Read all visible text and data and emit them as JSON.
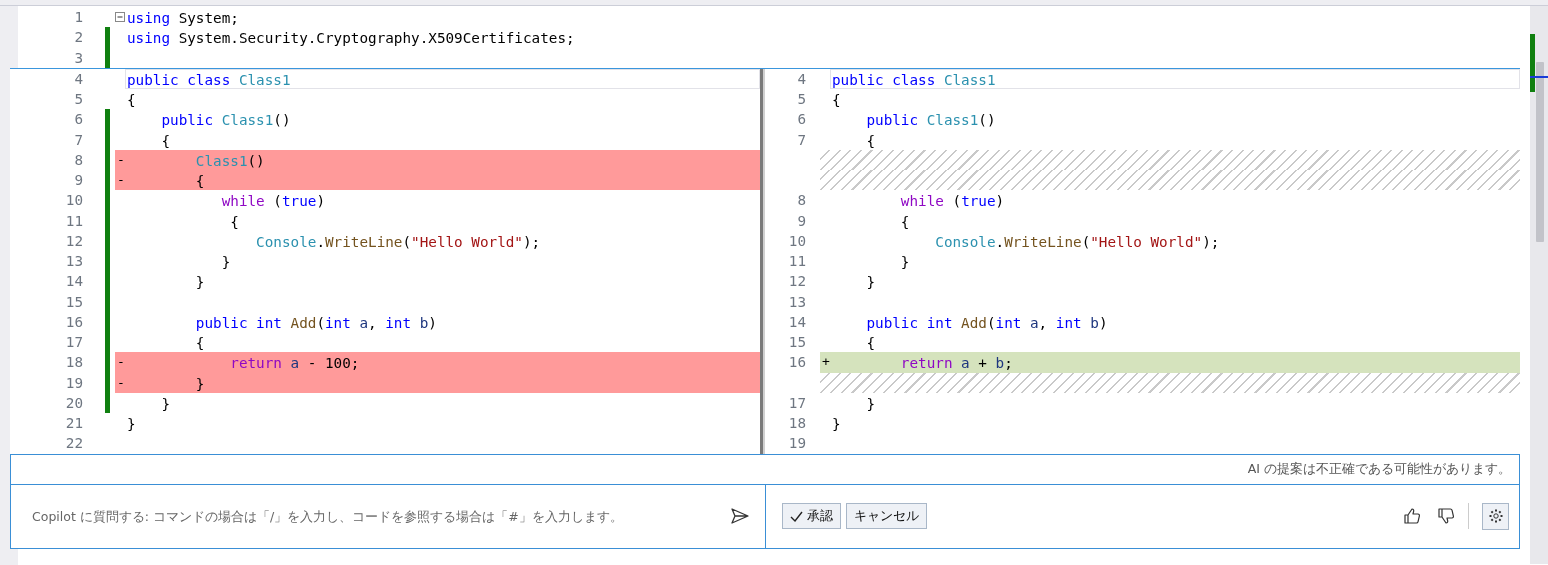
{
  "top_lines": [
    {
      "n": "1",
      "changed": false,
      "fold": true,
      "tokens": [
        {
          "kind": "kw",
          "text": "using"
        },
        {
          "kind": "plain",
          "text": " System;"
        }
      ]
    },
    {
      "n": "2",
      "changed": true,
      "fold": false,
      "tokens": [
        {
          "kind": "kw",
          "text": "using"
        },
        {
          "kind": "plain",
          "text": " System.Security.Cryptography.X509Certificates;"
        }
      ]
    },
    {
      "n": "3",
      "changed": true,
      "fold": false
    }
  ],
  "diff": {
    "left": [
      {
        "n": "4",
        "kind": "normal",
        "changed": false,
        "current": true,
        "tokens": [
          {
            "kind": "kw",
            "text": "public class"
          },
          {
            "kind": "type",
            "text": " Class1"
          }
        ]
      },
      {
        "n": "5",
        "kind": "normal",
        "changed": false,
        "current": false,
        "tokens": [
          {
            "kind": "plain",
            "text": "{"
          }
        ]
      },
      {
        "n": "6",
        "kind": "normal",
        "changed": true,
        "current": false,
        "tokens": [
          {
            "kind": "kw",
            "text": "    public"
          },
          {
            "kind": "type",
            "text": " Class1"
          },
          {
            "kind": "plain",
            "text": "()"
          }
        ]
      },
      {
        "n": "7",
        "kind": "normal",
        "changed": true,
        "current": false,
        "tokens": [
          {
            "kind": "plain",
            "text": "    {"
          }
        ]
      },
      {
        "n": "8",
        "kind": "removed",
        "marker": "-",
        "changed": true,
        "current": false,
        "tokens": [
          {
            "kind": "type",
            "text": "        Class1"
          },
          {
            "kind": "plain",
            "text": "()"
          }
        ]
      },
      {
        "n": "9",
        "kind": "removed",
        "marker": "-",
        "changed": true,
        "current": false,
        "tokens": [
          {
            "kind": "plain",
            "text": "        {"
          }
        ]
      },
      {
        "n": "10",
        "kind": "normal",
        "changed": true,
        "current": false,
        "tokens": [
          {
            "kind": "ctl",
            "text": "           while"
          },
          {
            "kind": "plain",
            "text": " ("
          },
          {
            "kind": "kw",
            "text": "true"
          },
          {
            "kind": "plain",
            "text": ")"
          }
        ]
      },
      {
        "n": "11",
        "kind": "normal",
        "changed": true,
        "current": false,
        "tokens": [
          {
            "kind": "plain",
            "text": "            {"
          }
        ]
      },
      {
        "n": "12",
        "kind": "normal",
        "changed": true,
        "current": false,
        "tokens": [
          {
            "kind": "type",
            "text": "               Console"
          },
          {
            "kind": "plain",
            "text": "."
          },
          {
            "kind": "method",
            "text": "WriteLine"
          },
          {
            "kind": "plain",
            "text": "("
          },
          {
            "kind": "str",
            "text": "\"Hello World\""
          },
          {
            "kind": "plain",
            "text": ");"
          }
        ]
      },
      {
        "n": "13",
        "kind": "normal",
        "changed": true,
        "current": false,
        "tokens": [
          {
            "kind": "plain",
            "text": "           }"
          }
        ]
      },
      {
        "n": "14",
        "kind": "normal",
        "changed": true,
        "current": false,
        "tokens": [
          {
            "kind": "plain",
            "text": "        }"
          }
        ]
      },
      {
        "n": "15",
        "kind": "normal",
        "changed": true,
        "current": false
      },
      {
        "n": "16",
        "kind": "normal",
        "changed": true,
        "current": false,
        "tokens": [
          {
            "kind": "kw",
            "text": "        public int"
          },
          {
            "kind": "method",
            "text": " Add"
          },
          {
            "kind": "plain",
            "text": "("
          },
          {
            "kind": "kw",
            "text": "int"
          },
          {
            "kind": "param",
            "text": " a"
          },
          {
            "kind": "plain",
            "text": ", "
          },
          {
            "kind": "kw",
            "text": "int"
          },
          {
            "kind": "param",
            "text": " b"
          },
          {
            "kind": "plain",
            "text": ")"
          }
        ]
      },
      {
        "n": "17",
        "kind": "normal",
        "changed": true,
        "current": false,
        "tokens": [
          {
            "kind": "plain",
            "text": "        {"
          }
        ]
      },
      {
        "n": "18",
        "kind": "removed",
        "marker": "-",
        "changed": true,
        "current": false,
        "tokens": [
          {
            "kind": "ctl",
            "text": "            return"
          },
          {
            "kind": "param",
            "text": " a"
          },
          {
            "kind": "plain",
            "text": " - 100;"
          }
        ]
      },
      {
        "n": "19",
        "kind": "removed",
        "marker": "-",
        "changed": true,
        "current": false,
        "tokens": [
          {
            "kind": "plain",
            "text": "        }"
          }
        ]
      },
      {
        "n": "20",
        "kind": "normal",
        "changed": true,
        "current": false,
        "tokens": [
          {
            "kind": "plain",
            "text": "    }"
          }
        ]
      },
      {
        "n": "21",
        "kind": "normal",
        "changed": false,
        "current": false,
        "tokens": [
          {
            "kind": "plain",
            "text": "}"
          }
        ]
      },
      {
        "n": "22",
        "kind": "normal",
        "changed": false,
        "current": false
      }
    ],
    "right": [
      {
        "n": "4",
        "kind": "normal",
        "current": true,
        "tokens": [
          {
            "kind": "kw",
            "text": "public class"
          },
          {
            "kind": "type",
            "text": " Class1"
          }
        ]
      },
      {
        "n": "5",
        "kind": "normal",
        "current": false,
        "tokens": [
          {
            "kind": "plain",
            "text": "{"
          }
        ]
      },
      {
        "n": "6",
        "kind": "normal",
        "current": false,
        "tokens": [
          {
            "kind": "kw",
            "text": "    public"
          },
          {
            "kind": "type",
            "text": " Class1"
          },
          {
            "kind": "plain",
            "text": "()"
          }
        ]
      },
      {
        "n": "7",
        "kind": "normal",
        "current": false,
        "tokens": [
          {
            "kind": "plain",
            "text": "    {"
          }
        ]
      },
      {
        "kind": "spacer",
        "current": false
      },
      {
        "kind": "spacer",
        "current": false
      },
      {
        "n": "8",
        "kind": "normal",
        "current": false,
        "tokens": [
          {
            "kind": "ctl",
            "text": "        while"
          },
          {
            "kind": "plain",
            "text": " ("
          },
          {
            "kind": "kw",
            "text": "true"
          },
          {
            "kind": "plain",
            "text": ")"
          }
        ]
      },
      {
        "n": "9",
        "kind": "normal",
        "current": false,
        "tokens": [
          {
            "kind": "plain",
            "text": "        {"
          }
        ]
      },
      {
        "n": "10",
        "kind": "normal",
        "current": false,
        "tokens": [
          {
            "kind": "type",
            "text": "            Console"
          },
          {
            "kind": "plain",
            "text": "."
          },
          {
            "kind": "method",
            "text": "WriteLine"
          },
          {
            "kind": "plain",
            "text": "("
          },
          {
            "kind": "str",
            "text": "\"Hello World\""
          },
          {
            "kind": "plain",
            "text": ");"
          }
        ]
      },
      {
        "n": "11",
        "kind": "normal",
        "current": false,
        "tokens": [
          {
            "kind": "plain",
            "text": "        }"
          }
        ]
      },
      {
        "n": "12",
        "kind": "normal",
        "current": false,
        "tokens": [
          {
            "kind": "plain",
            "text": "    }"
          }
        ]
      },
      {
        "n": "13",
        "kind": "normal",
        "current": false
      },
      {
        "n": "14",
        "kind": "normal",
        "current": false,
        "tokens": [
          {
            "kind": "kw",
            "text": "    public int"
          },
          {
            "kind": "method",
            "text": " Add"
          },
          {
            "kind": "plain",
            "text": "("
          },
          {
            "kind": "kw",
            "text": "int"
          },
          {
            "kind": "param",
            "text": " a"
          },
          {
            "kind": "plain",
            "text": ", "
          },
          {
            "kind": "kw",
            "text": "int"
          },
          {
            "kind": "param",
            "text": " b"
          },
          {
            "kind": "plain",
            "text": ")"
          }
        ]
      },
      {
        "n": "15",
        "kind": "normal",
        "current": false,
        "tokens": [
          {
            "kind": "plain",
            "text": "    {"
          }
        ]
      },
      {
        "n": "16",
        "kind": "added",
        "marker": "+",
        "current": false,
        "tokens": [
          {
            "kind": "ctl",
            "text": "        return"
          },
          {
            "kind": "param",
            "text": " a"
          },
          {
            "kind": "plain",
            "text": " + "
          },
          {
            "kind": "param",
            "text": "b"
          },
          {
            "kind": "plain",
            "text": ";"
          }
        ]
      },
      {
        "kind": "spacer",
        "current": false
      },
      {
        "n": "17",
        "kind": "normal",
        "current": false,
        "tokens": [
          {
            "kind": "plain",
            "text": "    }"
          }
        ]
      },
      {
        "n": "18",
        "kind": "normal",
        "current": false,
        "tokens": [
          {
            "kind": "plain",
            "text": "}"
          }
        ]
      },
      {
        "n": "19",
        "kind": "normal",
        "current": false
      }
    ]
  },
  "copilot": {
    "notice": "AI の提案は不正確である可能性があります。",
    "prompt": {
      "placeholder": "Copilot に質問する: コマンドの場合は「/」を入力し、コードを参照する場合は「#」を入力します。"
    },
    "buttons": [
      {
        "kind": "accept",
        "label": "承認"
      },
      {
        "kind": "cancel",
        "label": "キャンセル"
      }
    ]
  }
}
